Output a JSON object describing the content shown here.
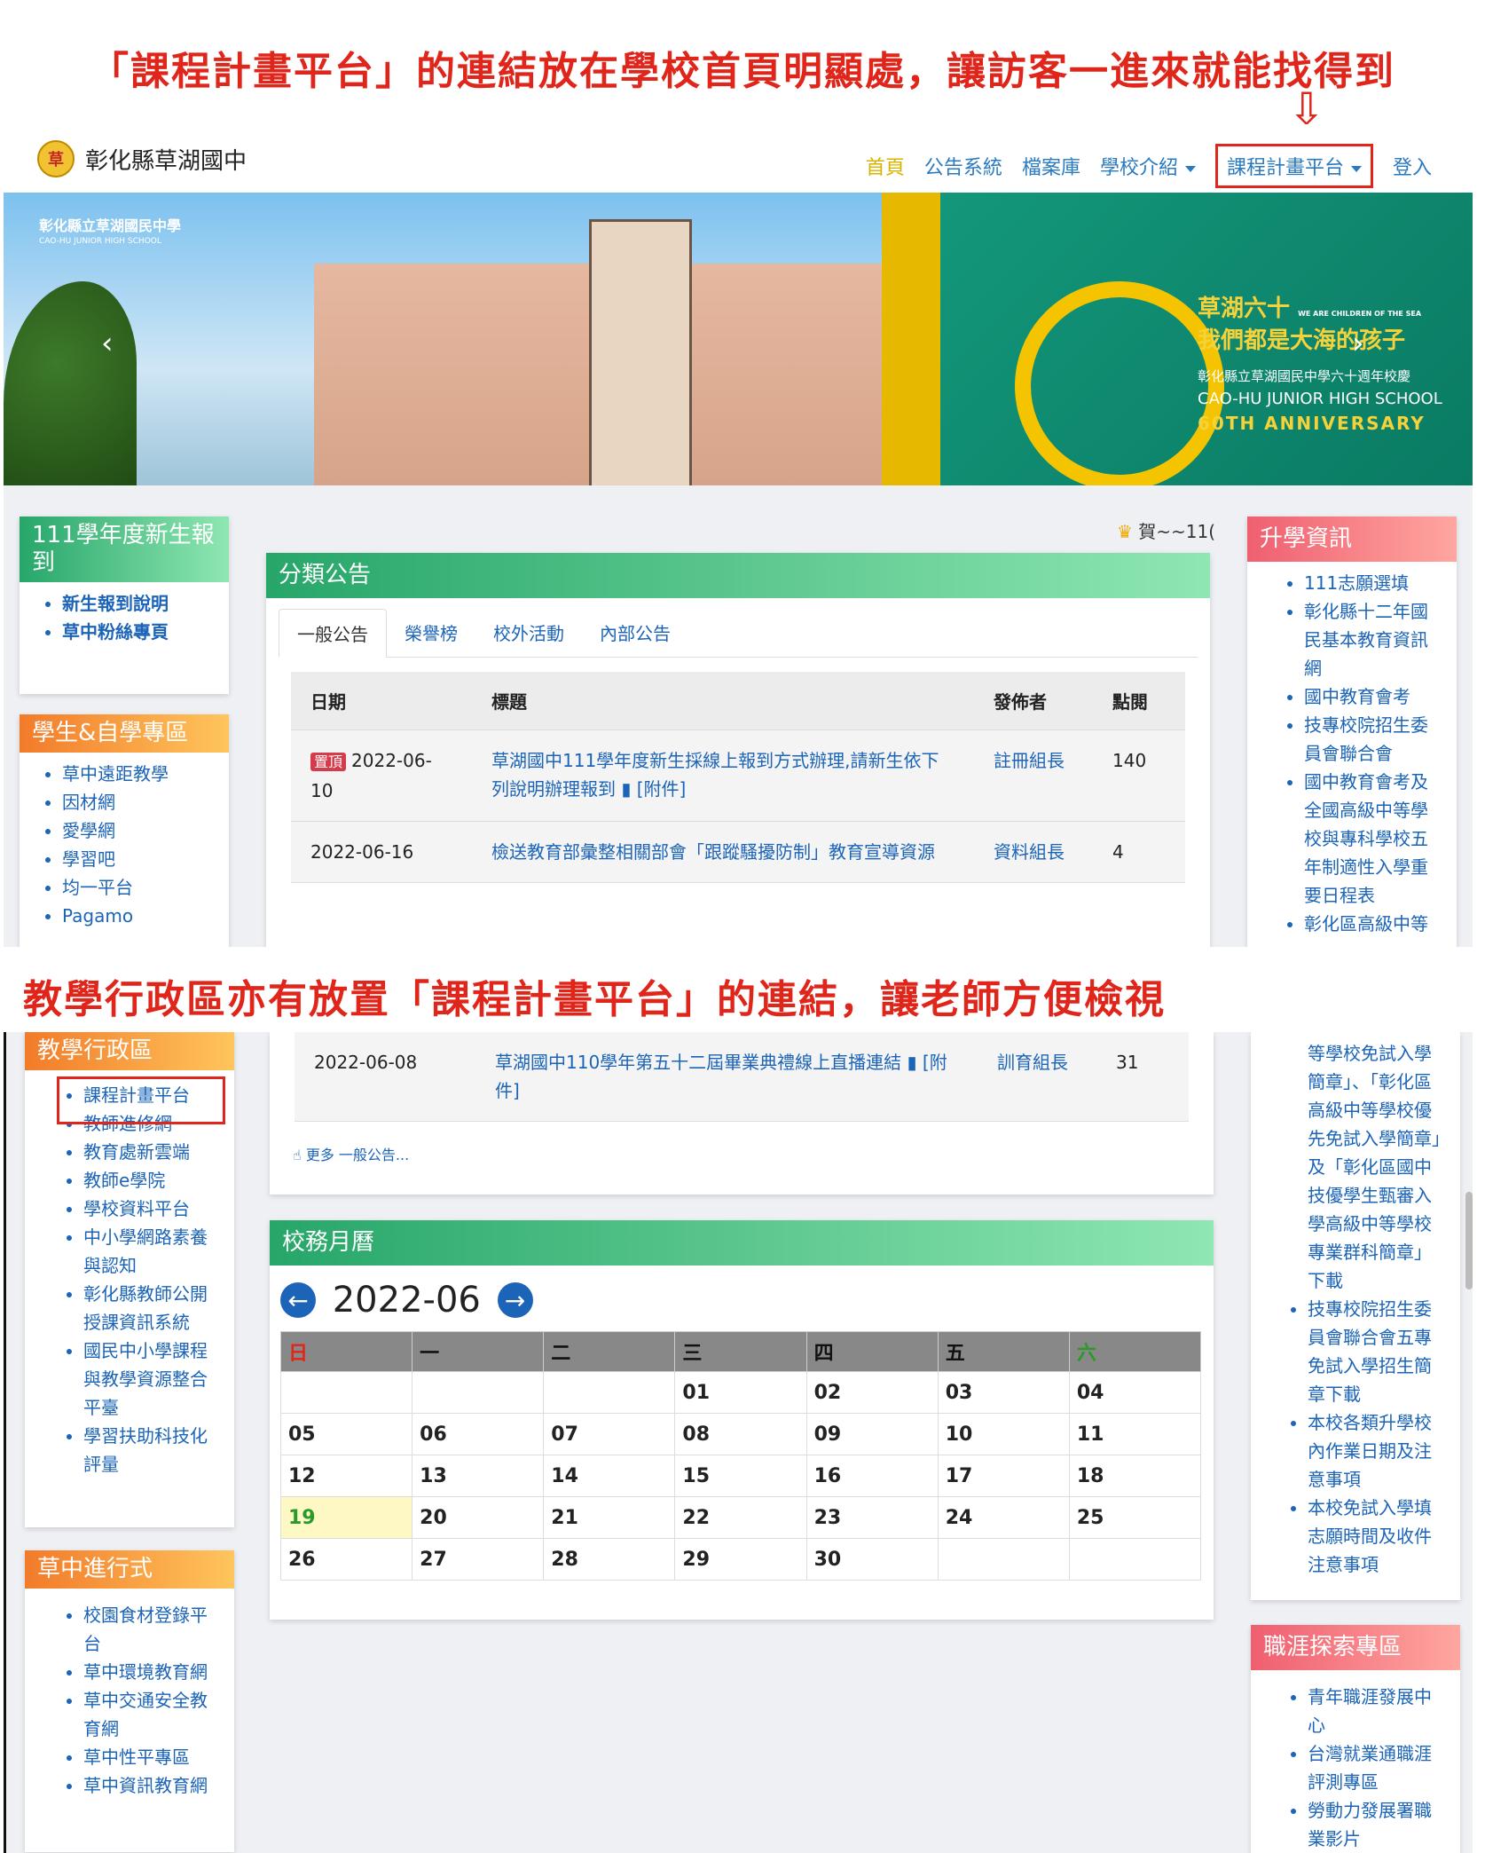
{
  "captions": {
    "top": "「課程計畫平台」的連結放在學校首頁明顯處，讓訪客一進來就能找得到",
    "middle": "教學行政區亦有放置「課程計畫平台」的連結，讓老師方便檢視"
  },
  "brand": {
    "logo_text": "草",
    "name": "彰化縣草湖國中"
  },
  "menu": {
    "home": "首頁",
    "items": [
      "公告系統",
      "檔案庫",
      "學校介紹",
      "課程計畫平台",
      "登入"
    ]
  },
  "hero": {
    "left_title": "彰化縣立草湖國民中學",
    "left_sub": "CAO-HU JUNIOR HIGH SCHOOL",
    "r1": "草湖六十",
    "r1_small": "WE ARE CHILDREN OF THE SEA",
    "r2": "我們都是大海的孩子",
    "r3": "彰化縣立草湖國民中學六十週年校慶",
    "r4": "CAO-HU JUNIOR HIGH SCHOOL",
    "r5": "60TH ANNIVERSARY"
  },
  "marquee": "賀~~11(",
  "left1": {
    "title": "111學年度新生報到",
    "items": [
      "新生報到說明",
      "草中粉絲專頁"
    ]
  },
  "left2": {
    "title": "學生&自學專區",
    "items": [
      "草中遠距教學",
      "因材網",
      "愛學網",
      "學習吧",
      "均一平台",
      "Pagamo"
    ]
  },
  "left3": {
    "title": "教學行政區",
    "items": [
      "課程計畫平台",
      "教師進修網",
      "教育處新雲端",
      "教師e學院",
      "學校資料平台",
      "中小學網路素養與認知",
      "彰化縣教師公開授課資訊系統",
      "國民中小學課程與教學資源整合平臺",
      "學習扶助科技化評量"
    ]
  },
  "left4": {
    "title": "草中進行式",
    "items": [
      "校園食材登錄平台",
      "草中環境教育網",
      "草中交通安全教育網",
      "草中性平專區",
      "草中資訊教育網"
    ]
  },
  "right1": {
    "title": "升學資訊",
    "items": [
      "111志願選填",
      "彰化縣十二年國民基本教育資訊網",
      "國中教育會考",
      "技專校院招生委員會聯合會",
      "國中教育會考及全國高級中等學校與專科學校五年制適性入學重要日程表",
      "彰化區高級中等"
    ]
  },
  "right1b": {
    "cont": "等學校免試入學簡章」、「彰化區高級中等學校優先免試入學簡章」及「彰化區國中技優學生甄審入學高級中等學校專業群科簡章」下載",
    "items": [
      "技專校院招生委員會聯合會五專免試入學招生簡章下載",
      "本校各類升學校內作業日期及注意事項",
      "本校免試入學填志願時間及收件注意事項"
    ]
  },
  "right2": {
    "title": "職涯探索專區",
    "items": [
      "青年職涯發展中心",
      "台灣就業通職涯評測專區",
      "勞動力發展署職業影片"
    ]
  },
  "announce": {
    "title": "分類公告",
    "tabs": [
      "一般公告",
      "榮譽榜",
      "校外活動",
      "內部公告"
    ],
    "headers": [
      "日期",
      "標題",
      "發佈者",
      "點閱"
    ],
    "pin_label": "置頂",
    "rows": [
      {
        "date": "2022-06-10",
        "title": "草湖國中111學年度新生採線上報到方式辦理,請新生依下列說明辦理報到",
        "attach": "[附件]",
        "author": "註冊組長",
        "hits": "140"
      },
      {
        "date": "2022-06-16",
        "title": "檢送教育部彙整相關部會「跟蹤騷擾防制」教育宣導資源",
        "attach": "",
        "author": "資料組長",
        "hits": "4"
      },
      {
        "date": "2022-06-08",
        "title": "草湖國中110學年第五十二屆畢業典禮線上直播連結",
        "attach": "[附件]",
        "author": "訓育組長",
        "hits": "31"
      }
    ],
    "more": "更多 一般公告..."
  },
  "calendar": {
    "title": "校務月曆",
    "month": "2022-06",
    "weekdays": [
      "日",
      "一",
      "二",
      "三",
      "四",
      "五",
      "六"
    ],
    "weeks": [
      [
        "",
        "",
        "",
        "01",
        "02",
        "03",
        "04"
      ],
      [
        "05",
        "06",
        "07",
        "08",
        "09",
        "10",
        "11"
      ],
      [
        "12",
        "13",
        "14",
        "15",
        "16",
        "17",
        "18"
      ],
      [
        "19",
        "20",
        "21",
        "22",
        "23",
        "24",
        "25"
      ],
      [
        "26",
        "27",
        "28",
        "29",
        "30",
        "",
        ""
      ]
    ],
    "today": "19"
  },
  "colors": {
    "accent_red": "#e0251b",
    "link_blue": "#1b64b8",
    "green_header": "#27a66a",
    "orange_header": "#f27b2a",
    "pink_header": "#ef5f70"
  }
}
